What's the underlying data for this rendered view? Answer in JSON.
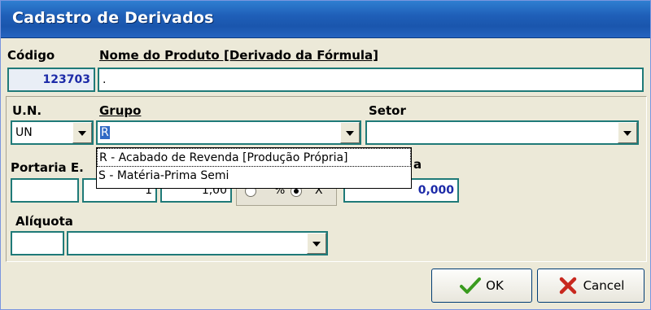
{
  "window": {
    "title": "Cadastro de Derivados"
  },
  "labels": {
    "codigo": "Código",
    "nome_produto": "Nome do Produto [Derivado da Fórmula]",
    "un": "U.N.",
    "grupo": "Grupo",
    "setor": "Setor",
    "portaria": "Portaria E.",
    "a_partial": "a",
    "aliquota": "Alíquota"
  },
  "fields": {
    "codigo": "123703",
    "nome_produto": ".",
    "un": "UN",
    "grupo": "R",
    "setor": "",
    "portaria": "",
    "qty1": "1",
    "qty2": "1,00",
    "value": "0,000",
    "aliquota_code": "",
    "aliquota_desc": ""
  },
  "grupo_options": [
    "R - Acabado de Revenda [Produção Própria]",
    "S - Matéria-Prima Semi"
  ],
  "radio": {
    "percent_label": "%",
    "x_label": "X",
    "selected": "x"
  },
  "buttons": {
    "ok": "OK",
    "cancel": "Cancel"
  },
  "colors": {
    "title_bar": "#1f5fb8",
    "field_border": "#1f7a78",
    "accent_text": "#1c2aa8",
    "ok_check": "#3a9b1f",
    "cancel_x": "#c8281e"
  }
}
